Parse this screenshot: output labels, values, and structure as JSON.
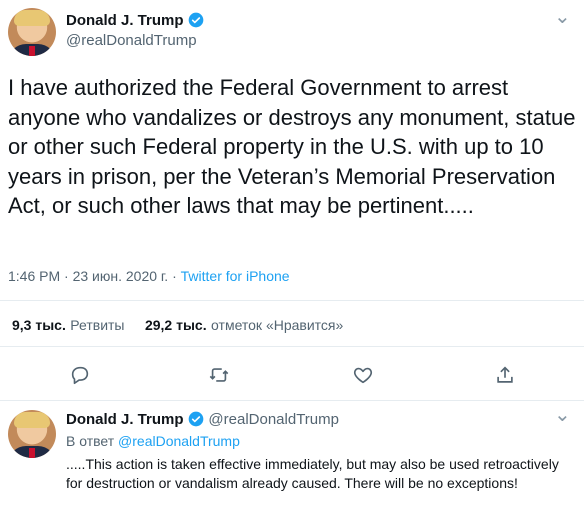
{
  "tweet": {
    "author_name": "Donald J. Trump",
    "author_handle": "@realDonaldTrump",
    "text": "I have authorized the Federal Government to arrest anyone who vandalizes or destroys any monument, statue or other such Federal property in the U.S. with up to 10 years in prison, per the Veteran’s Memorial Preservation Act, or such other laws that may be pertinent.....",
    "time": "1:46 PM · 23 июн. 2020 г. · ",
    "source": "Twitter for iPhone",
    "retweets_count": "9,3 тыс.",
    "retweets_label": "Ретвиты",
    "likes_count": "29,2 тыс.",
    "likes_label": "отметок «Нравится»"
  },
  "reply": {
    "author_name": "Donald J. Trump",
    "author_handle": "@realDonaldTrump",
    "reply_prefix": "В ответ ",
    "reply_to_handle": "@realDonaldTrump",
    "text": ".....This action is taken effective immediately, but may also be used retroactively for destruction or vandalism already caused. There will be no exceptions!"
  },
  "icons": [
    "more-icon",
    "verified-icon",
    "reply-icon",
    "retweet-icon",
    "like-icon",
    "share-icon"
  ],
  "colors": {
    "accent": "#1da1f2",
    "text": "#0f1419",
    "muted": "#536471",
    "divider": "#e6ecf0"
  }
}
